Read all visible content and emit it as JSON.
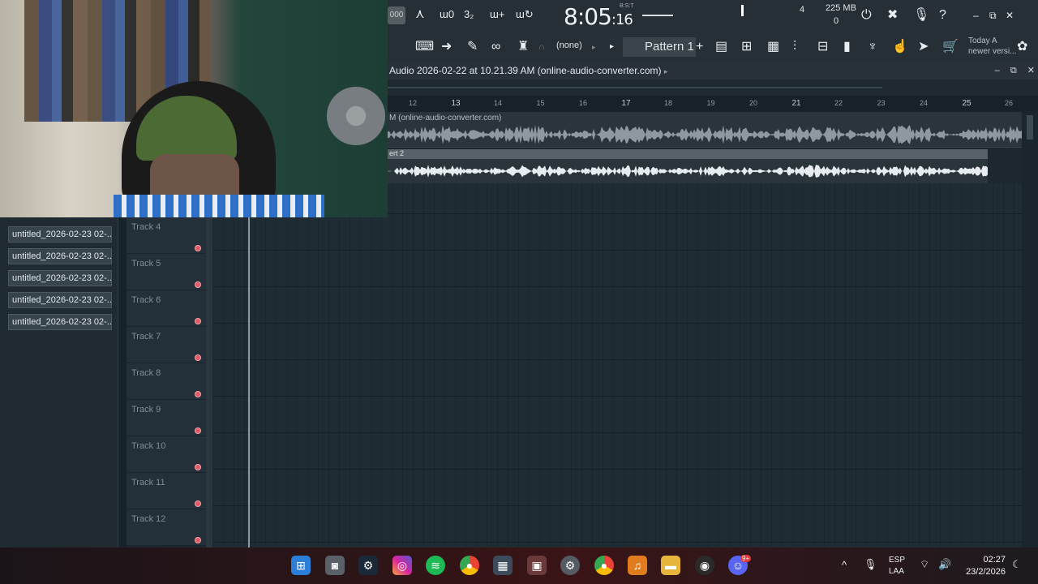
{
  "toolbar": {
    "clip_label": "000",
    "time_main": "8:05",
    "time_ticks": ":16",
    "time_unit": "B:S:T",
    "cpu_value": "4",
    "memory": "225 MB",
    "memory_zero": "0",
    "snap_label": "(none)",
    "pattern_label": "Pattern 1",
    "update_line1": "Today  A",
    "update_line2": "newer versi..."
  },
  "playlist": {
    "title": "Audio 2026-02-22 at 10.21.39 AM (online-audio-converter.com)",
    "title_arrow": "▸",
    "ruler": [
      "12",
      "13",
      "14",
      "15",
      "16",
      "17",
      "18",
      "19",
      "20",
      "21",
      "22",
      "23",
      "24",
      "25",
      "26"
    ],
    "clip1_label": "M (online-audio-converter.com)",
    "clip2_label": "ert 2"
  },
  "patterns": [
    "untitled_2026-02-23 02-...",
    "untitled_2026-02-23 02-...",
    "untitled_2026-02-23 02-...",
    "untitled_2026-02-23 02-...",
    "untitled_2026-02-23 02-..."
  ],
  "tracks": [
    "Track 4",
    "Track 5",
    "Track 6",
    "Track 7",
    "Track 8",
    "Track 9",
    "Track 10",
    "Track 11",
    "Track 12"
  ],
  "taskbar": {
    "lang1": "ESP",
    "lang2": "LAA",
    "time": "02:27",
    "date": "23/2/2026",
    "discord_badge": "9+"
  },
  "colors": {
    "accent_record": "#e25a66",
    "grid_bg": "#202c34"
  }
}
